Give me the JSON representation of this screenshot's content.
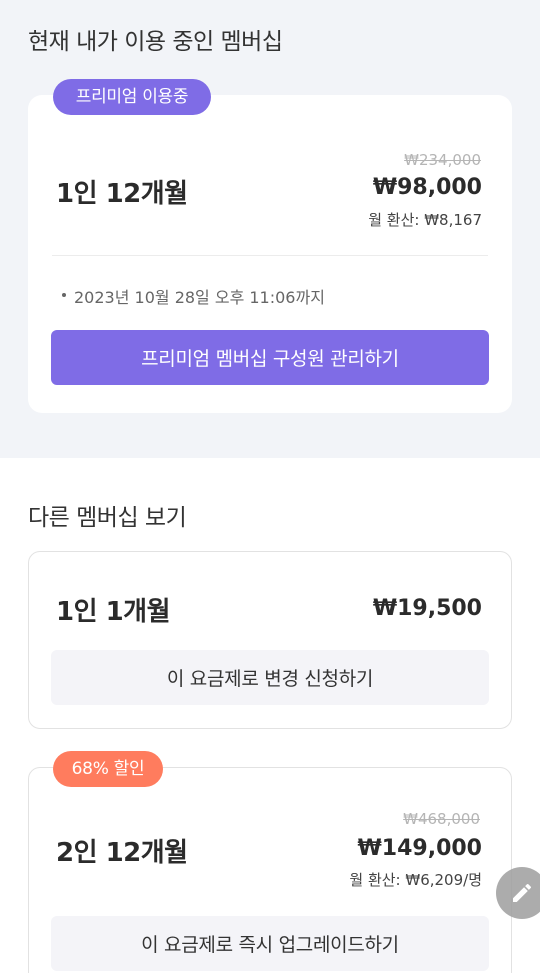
{
  "current_section": {
    "title": "현재 내가 이용 중인 멤버십",
    "badge": "프리미엄 이용중",
    "plan_name": "1인 12개월",
    "original_price": "₩234,000",
    "price": "₩98,000",
    "monthly": "월 환산: ₩8,167",
    "expiry": "2023년 10월 28일 오후 11:06까지",
    "manage_button": "프리미엄 멤버십 구성원 관리하기"
  },
  "other_section": {
    "title": "다른 멤버십 보기",
    "plans": [
      {
        "plan_name": "1인 1개월",
        "price": "₩19,500",
        "button": "이 요금제로 변경 신청하기"
      },
      {
        "badge": "68% 할인",
        "plan_name": "2인 12개월",
        "original_price": "₩468,000",
        "price": "₩149,000",
        "monthly": "월 환산: ₩6,209/명",
        "button": "이 요금제로 즉시 업그레이드하기"
      }
    ]
  },
  "fab": {
    "icon": "pencil-icon"
  },
  "colors": {
    "accent": "#7f6ce6",
    "discount": "#ff7c5e",
    "section_bg": "#f2f4f8"
  }
}
